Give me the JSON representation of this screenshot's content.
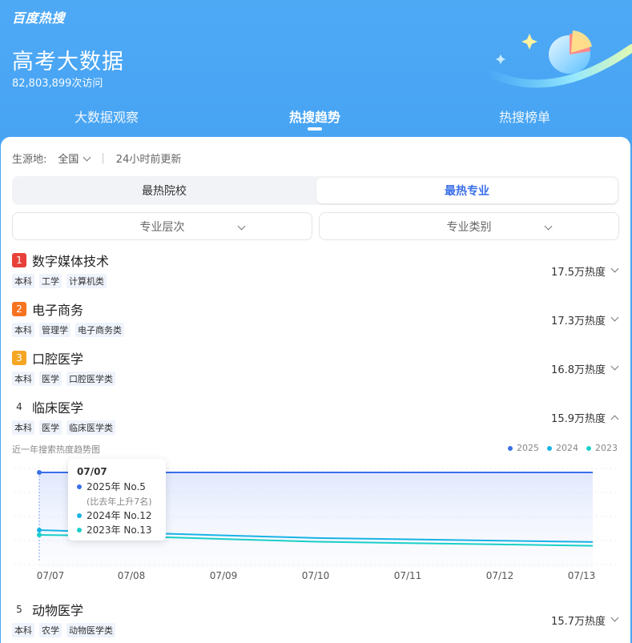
{
  "header": {
    "brand": "百度热搜",
    "title": "高考大数据",
    "visits": "82,803,899次访问"
  },
  "tabs": [
    {
      "label": "大数据观察",
      "active": false
    },
    {
      "label": "热搜趋势",
      "active": true
    },
    {
      "label": "热搜榜单",
      "active": false
    }
  ],
  "filter": {
    "label": "生源地:",
    "value": "全国",
    "updated": "24小时前更新",
    "separator": "|"
  },
  "segment": {
    "left": "最热院校",
    "right": "最热专业",
    "selected": "最热专业"
  },
  "dropdowns": {
    "level": "专业层次",
    "category": "专业类别"
  },
  "items": [
    {
      "rank": "1",
      "name": "数字媒体技术",
      "tags": [
        "本科",
        "工学",
        "计算机类"
      ],
      "heat": "17.5万热度",
      "expanded": false
    },
    {
      "rank": "2",
      "name": "电子商务",
      "tags": [
        "本科",
        "管理学",
        "电子商务类"
      ],
      "heat": "17.3万热度",
      "expanded": false
    },
    {
      "rank": "3",
      "name": "口腔医学",
      "tags": [
        "本科",
        "医学",
        "口腔医学类"
      ],
      "heat": "16.8万热度",
      "expanded": false
    },
    {
      "rank": "4",
      "name": "临床医学",
      "tags": [
        "本科",
        "医学",
        "临床医学类"
      ],
      "heat": "15.9万热度",
      "expanded": true
    },
    {
      "rank": "5",
      "name": "动物医学",
      "tags": [
        "本科",
        "农学",
        "动物医学类"
      ],
      "heat": "15.7万热度",
      "expanded": false
    }
  ],
  "chart": {
    "title": "近一年搜索热度趋势图",
    "legend": [
      {
        "name": "2025",
        "color": "#3a6fe8"
      },
      {
        "name": "2024",
        "color": "#17b3e6"
      },
      {
        "name": "2023",
        "color": "#19cfc8"
      }
    ],
    "tooltip": {
      "date": "07/07",
      "row2025": "2025年 No.5",
      "note": "(比去年上升7名)",
      "row2024": "2024年 No.12",
      "row2023": "2023年 No.13"
    }
  },
  "chart_data": {
    "type": "line",
    "title": "近一年搜索热度趋势图",
    "x": [
      "07/07",
      "07/08",
      "07/09",
      "07/10",
      "07/11",
      "07/12",
      "07/13"
    ],
    "ylabel": "",
    "series": [
      {
        "name": "2025",
        "values": [
          5,
          5,
          5,
          5,
          5,
          5,
          5
        ]
      },
      {
        "name": "2024",
        "values": [
          12,
          13,
          14,
          15,
          15.5,
          16,
          16.5
        ]
      },
      {
        "name": "2023",
        "values": [
          13,
          13.5,
          14.5,
          15.5,
          16,
          16.5,
          17
        ]
      }
    ],
    "y_inverted": true,
    "legend_position": "top-right",
    "grid": true
  }
}
